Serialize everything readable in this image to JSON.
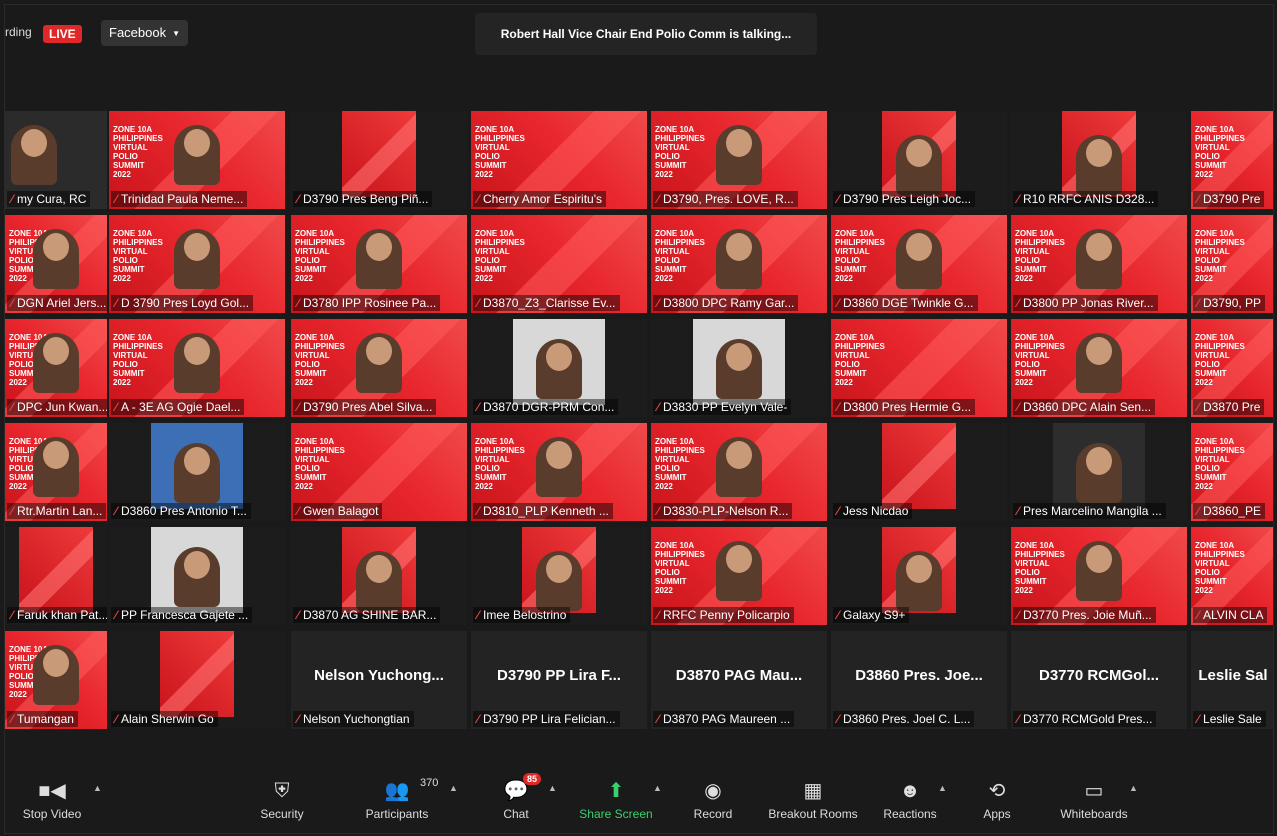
{
  "topbar": {
    "recording_label": "rding",
    "live_label": "LIVE",
    "stream_target": "Facebook",
    "talking_banner": "Robert Hall Vice Chair End Polio Comm is talking..."
  },
  "slide_text": [
    "ZONE 10A",
    "PHILIPPINES",
    "VIRTUAL",
    "POLIO",
    "SUMMIT",
    "2022"
  ],
  "tiles": [
    {
      "name": "my Cura, RC",
      "style": "dark"
    },
    {
      "name": "Trinidad Paula Neme...",
      "style": "slide-person"
    },
    {
      "name": "D3790 Pres Beng Piñ...",
      "style": "narrow"
    },
    {
      "name": "Cherry Amor Espiritu's",
      "style": "slide"
    },
    {
      "name": "D3790, Pres. LOVE, R...",
      "style": "slide-person"
    },
    {
      "name": "D3790 Pres Leigh Joc...",
      "style": "narrow-person"
    },
    {
      "name": "R10 RRFC ANIS D328...",
      "style": "narrow-person"
    },
    {
      "name": "D3790 Pre",
      "style": "slide"
    },
    {
      "name": "DGN Ariel Jers...",
      "style": "slide-person"
    },
    {
      "name": "D 3790 Pres Loyd Gol...",
      "style": "slide-person"
    },
    {
      "name": "D3780 IPP Rosinee Pa...",
      "style": "slide-person"
    },
    {
      "name": "D3870_Z3_Clarisse Ev...",
      "style": "slide"
    },
    {
      "name": "D3800 DPC Ramy Gar...",
      "style": "slide-person"
    },
    {
      "name": "D3860 DGE Twinkle G...",
      "style": "slide-person"
    },
    {
      "name": "D3800 PP Jonas River...",
      "style": "slide-person"
    },
    {
      "name": "D3790, PP",
      "style": "slide"
    },
    {
      "name": "DPC Jun Kwan...",
      "style": "slide-person"
    },
    {
      "name": "A - 3E  AG  Ogie Dael...",
      "style": "slide-person"
    },
    {
      "name": "D3790 Pres Abel Silva...",
      "style": "slide-person"
    },
    {
      "name": "D3870 DGR-PRM Con...",
      "style": "photo"
    },
    {
      "name": "D3830 PP Evelyn Vale-",
      "style": "photo"
    },
    {
      "name": "D3800 Pres Hermie G...",
      "style": "slide"
    },
    {
      "name": "D3860 DPC Alain Sen...",
      "style": "slide-person"
    },
    {
      "name": "D3870 Pre",
      "style": "slide"
    },
    {
      "name": "Rtr.Martin Lan...",
      "style": "slide-person"
    },
    {
      "name": "D3860 Pres Antonio T...",
      "style": "photo-blue"
    },
    {
      "name": "Gwen Balagot",
      "style": "slide"
    },
    {
      "name": "D3810_PLP Kenneth ...",
      "style": "slide-person"
    },
    {
      "name": "D3830-PLP-Nelson R...",
      "style": "slide-person"
    },
    {
      "name": "Jess Nicdao",
      "style": "narrow"
    },
    {
      "name": "Pres Marcelino Mangila ...",
      "style": "photo-dark"
    },
    {
      "name": "D3860_PE",
      "style": "slide"
    },
    {
      "name": "Faruk khan Pat...",
      "style": "narrow"
    },
    {
      "name": "PP Francesca Gajete ...",
      "style": "photo"
    },
    {
      "name": "D3870 AG SHINE BAR...",
      "style": "narrow-person"
    },
    {
      "name": "Imee Belostrino",
      "style": "narrow-person"
    },
    {
      "name": "RRFC Penny Policarpio",
      "style": "slide-person"
    },
    {
      "name": "Galaxy S9+",
      "style": "narrow-person"
    },
    {
      "name": "D3770 Pres. Joie Muñ...",
      "style": "slide-person"
    },
    {
      "name": "ALVIN CLA",
      "style": "slide"
    },
    {
      "name": "Tumangan",
      "style": "slide-person"
    },
    {
      "name": "Alain Sherwin Go",
      "style": "narrow"
    },
    {
      "name": "Nelson Yuchongtian",
      "big": "Nelson  Yuchong...",
      "style": "empty"
    },
    {
      "name": "D3790 PP Lira Felician...",
      "big": "D3790 PP Lira F...",
      "style": "empty"
    },
    {
      "name": "D3870 PAG Maureen ...",
      "big": "D3870 PAG Mau...",
      "style": "empty"
    },
    {
      "name": "D3860 Pres. Joel C. L...",
      "big": "D3860 Pres. Joe...",
      "style": "empty"
    },
    {
      "name": "D3770 RCMGold Pres...",
      "big": "D3770 RCMGol...",
      "style": "empty"
    },
    {
      "name": "Leslie Sale",
      "big": "Leslie Sal",
      "style": "empty"
    }
  ],
  "toolbar": {
    "stop_video": "Stop Video",
    "security": "Security",
    "participants": "Participants",
    "participants_count": "370",
    "chat": "Chat",
    "chat_badge": "85",
    "share_screen": "Share Screen",
    "record": "Record",
    "breakout_rooms": "Breakout Rooms",
    "reactions": "Reactions",
    "apps": "Apps",
    "whiteboards": "Whiteboards"
  },
  "colors": {
    "background": "#1a1a1a",
    "live_red": "#e02828",
    "share_green": "#3ad06d",
    "slide_red": "#e8262d"
  }
}
